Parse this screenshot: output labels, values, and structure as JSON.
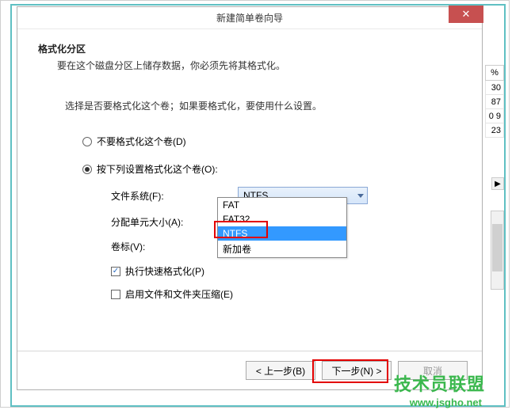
{
  "dialog": {
    "title": "新建简单卷向导",
    "heading": "格式化分区",
    "sub": "要在这个磁盘分区上储存数据，你必须先将其格式化。",
    "desc": "选择是否要格式化这个卷；如果要格式化，要使用什么设置。"
  },
  "radio": {
    "noFormat": "不要格式化这个卷(D)",
    "formatWith": "按下列设置格式化这个卷(O):"
  },
  "form": {
    "fsLabel": "文件系统(F):",
    "fsValue": "NTFS",
    "allocLabel": "分配单元大小(A):",
    "volLabel": "卷标(V):",
    "volValue": "新加卷"
  },
  "dropdown": {
    "items": [
      "FAT",
      "FAT32",
      "NTFS"
    ]
  },
  "checks": {
    "quick": "执行快速格式化(P)",
    "compress": "启用文件和文件夹压缩(E)"
  },
  "buttons": {
    "back": "< 上一步(B)",
    "next": "下一步(N) >",
    "cancel": "取消"
  },
  "rightCol": {
    "header": "%",
    "rows": [
      "30",
      "87",
      "0 9",
      "23"
    ]
  },
  "watermark": {
    "line1": "技术员联盟",
    "line2": "www.jsgho.net"
  }
}
